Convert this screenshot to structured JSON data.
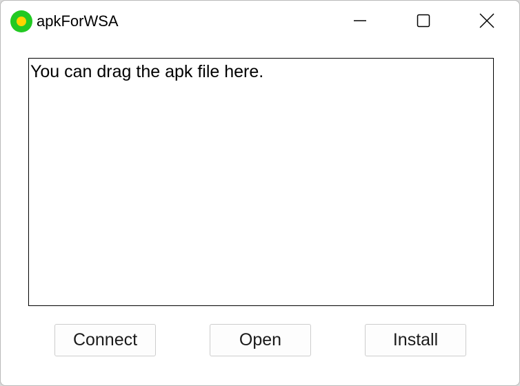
{
  "window": {
    "title": "apkForWSA",
    "icon": "app-icon-yellow-green-circle",
    "controls": {
      "minimize_icon": "minimize-icon",
      "maximize_icon": "maximize-icon",
      "close_icon": "close-icon"
    }
  },
  "drop_area": {
    "text": "You can drag the apk file here."
  },
  "buttons": {
    "connect_label": "Connect",
    "open_label": "Open",
    "install_label": "Install"
  },
  "colors": {
    "icon_outer": "#22c922",
    "icon_inner": "#ffd400"
  }
}
